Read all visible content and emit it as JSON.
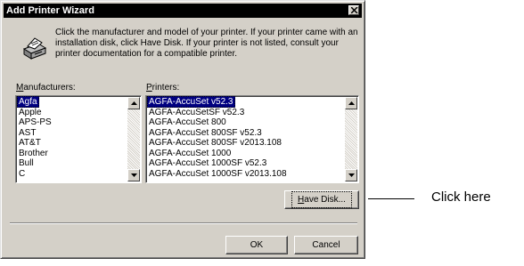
{
  "window": {
    "title": "Add Printer Wizard",
    "close_label": "close"
  },
  "instructions": "Click the manufacturer and model of your printer.  If your printer came with an installation disk, click Have Disk.  If your printer is not listed, consult your printer documentation for a compatible printer.",
  "manufacturers": {
    "label_access_key": "M",
    "label_rest": "anufacturers:",
    "items": [
      "Agfa",
      "Apple",
      "APS-PS",
      "AST",
      "AT&T",
      "Brother",
      "Bull",
      "C"
    ],
    "selected_index": 0
  },
  "printers": {
    "label_access_key": "P",
    "label_rest": "rinters:",
    "items": [
      "AGFA-AccuSet v52.3",
      "AGFA-AccuSetSF v52.3",
      "AGFA-AccuSet 800",
      "AGFA-AccuSet 800SF v52.3",
      "AGFA-AccuSet 800SF v2013.108",
      "AGFA-AccuSet 1000",
      "AGFA-AccuSet 1000SF v52.3",
      "AGFA-AccuSet 1000SF v2013.108"
    ],
    "selected_index": 0
  },
  "buttons": {
    "have_disk_key": "H",
    "have_disk_rest": "ave Disk...",
    "ok": "OK",
    "cancel": "Cancel"
  },
  "callout": "Click here",
  "icons": {
    "printer": "printer-icon",
    "close": "close-icon",
    "scroll_up": "arrow-up-icon",
    "scroll_down": "arrow-down-icon"
  },
  "colors": {
    "titlebar": "#000000",
    "face": "#d4d0c8",
    "selection": "#000080"
  }
}
